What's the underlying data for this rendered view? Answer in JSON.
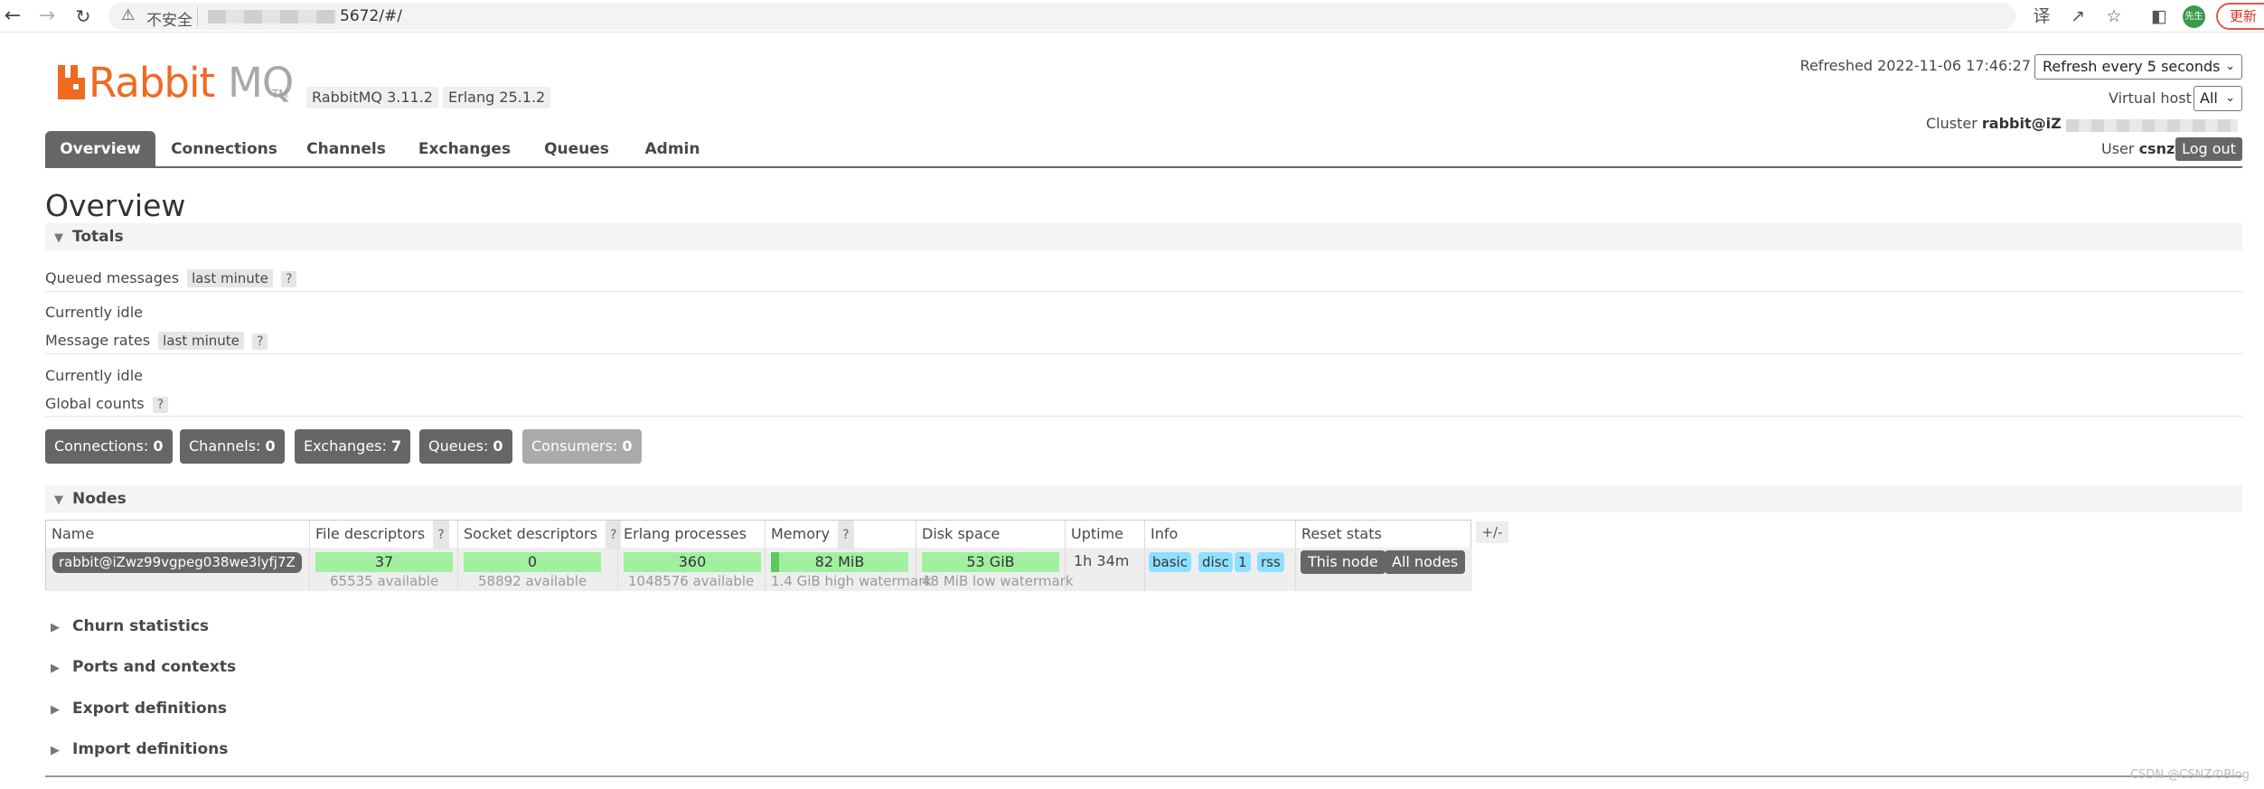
{
  "browser": {
    "insecure_label": "不安全",
    "url_suffix": "5672/#/",
    "profile_label": "先生",
    "update_label": "更新"
  },
  "header": {
    "logo_rabbit": "Rabbit",
    "logo_mq": "MQ",
    "logo_tm": "TM",
    "rabbitmq_version": "RabbitMQ 3.11.2",
    "erlang_version": "Erlang 25.1.2",
    "refreshed": "Refreshed 2022-11-06 17:46:27",
    "refresh_option": "Refresh every 5 seconds",
    "vhost_label": "Virtual host",
    "vhost_value": "All",
    "cluster_label": "Cluster",
    "cluster_name": "rabbit@iZ",
    "user_label": "User",
    "user_name": "csnz",
    "logout_label": "Log out"
  },
  "tabs": [
    "Overview",
    "Connections",
    "Channels",
    "Exchanges",
    "Queues",
    "Admin"
  ],
  "active_tab": "Overview",
  "page_title": "Overview",
  "totals": {
    "heading": "Totals",
    "queued_label": "Queued messages",
    "queued_period": "last minute",
    "help": "?",
    "queued_status": "Currently idle",
    "rates_label": "Message rates",
    "rates_period": "last minute",
    "rates_status": "Currently idle",
    "global_label": "Global counts"
  },
  "global_counts": [
    {
      "label": "Connections:",
      "value": "0"
    },
    {
      "label": "Channels:",
      "value": "0"
    },
    {
      "label": "Exchanges:",
      "value": "7"
    },
    {
      "label": "Queues:",
      "value": "0"
    },
    {
      "label": "Consumers:",
      "value": "0"
    }
  ],
  "nodes": {
    "heading": "Nodes",
    "columns": [
      "Name",
      "File descriptors",
      "Socket descriptors",
      "Erlang processes",
      "Memory",
      "Disk space",
      "Uptime",
      "Info",
      "Reset stats"
    ],
    "help": "?",
    "row": {
      "name": "rabbit@iZwz99vgpeg038we3lyfj7Z",
      "file_descriptors": "37",
      "file_descriptors_sub": "65535 available",
      "socket_descriptors": "0",
      "socket_descriptors_sub": "58892 available",
      "erlang_processes": "360",
      "erlang_processes_sub": "1048576 available",
      "memory": "82 MiB",
      "memory_sub": "1.4 GiB high watermark",
      "memory_fraction": 0.06,
      "disk": "53 GiB",
      "disk_sub": "48 MiB low watermark",
      "uptime": "1h 34m",
      "info": [
        "basic",
        "disc",
        "1",
        "rss"
      ],
      "reset_this": "This node",
      "reset_all": "All nodes"
    },
    "plusminus": "+/-"
  },
  "collapsed_sections": [
    "Churn statistics",
    "Ports and contexts",
    "Export definitions",
    "Import definitions"
  ],
  "watermark": "CSDN @CSNZのBlog",
  "colors": {
    "accent_orange": "#f06a21",
    "tab_grey": "#666666",
    "gauge_green": "#a0f0a0",
    "info_blue": "#8fe0ff"
  }
}
